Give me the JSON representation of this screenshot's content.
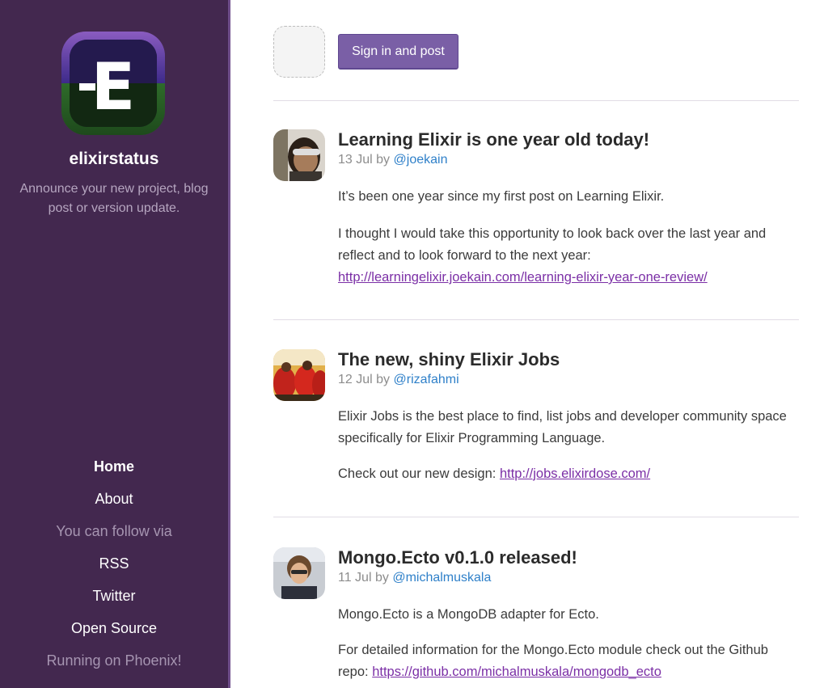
{
  "sidebar": {
    "logo_letter": "E",
    "site_name": "elixirstatus",
    "tagline": "Announce your new project, blog post or version update.",
    "nav": [
      {
        "label": "Home",
        "style": "bold"
      },
      {
        "label": "About",
        "style": "normal"
      },
      {
        "label": "You can follow via",
        "style": "muted"
      },
      {
        "label": "RSS",
        "style": "normal"
      },
      {
        "label": "Twitter",
        "style": "normal"
      },
      {
        "label": "Open Source",
        "style": "normal"
      },
      {
        "label": "Running on Phoenix!",
        "style": "muted"
      }
    ]
  },
  "composer": {
    "signin_label": "Sign in and post"
  },
  "posts": [
    {
      "title": "Learning Elixir is one year old today!",
      "date": "13 Jul",
      "by": "by",
      "author": "@joekain",
      "paragraphs": [
        {
          "text": "It’s been one year since my first post on Learning Elixir.",
          "link": ""
        },
        {
          "text": "I thought I would take this opportunity to look back over the last year and reflect and to look forward to the next year: ",
          "link": "http://learningelixir.joekain.com/learning-elixir-year-one-review/"
        }
      ]
    },
    {
      "title": "The new, shiny Elixir Jobs",
      "date": "12 Jul",
      "by": "by",
      "author": "@rizafahmi",
      "paragraphs": [
        {
          "text": "Elixir Jobs is the best place to find, list jobs and developer community space specifically for Elixir Programming Language.",
          "link": ""
        },
        {
          "text": "Check out our new design: ",
          "link": "http://jobs.elixirdose.com/"
        }
      ]
    },
    {
      "title": "Mongo.Ecto v0.1.0 released!",
      "date": "11 Jul",
      "by": "by",
      "author": "@michalmuskala",
      "paragraphs": [
        {
          "text": "Mongo.Ecto is a MongoDB adapter for Ecto.",
          "link": ""
        },
        {
          "text": "For detailed information for the Mongo.Ecto module check out the Github repo: ",
          "link": "https://github.com/michalmuskala/mongodb_ecto"
        }
      ]
    }
  ],
  "colors": {
    "sidebar_bg": "#43284f",
    "accent": "#7a5fa6",
    "author_link": "#2f80c9",
    "body_link": "#7b2fa6"
  }
}
